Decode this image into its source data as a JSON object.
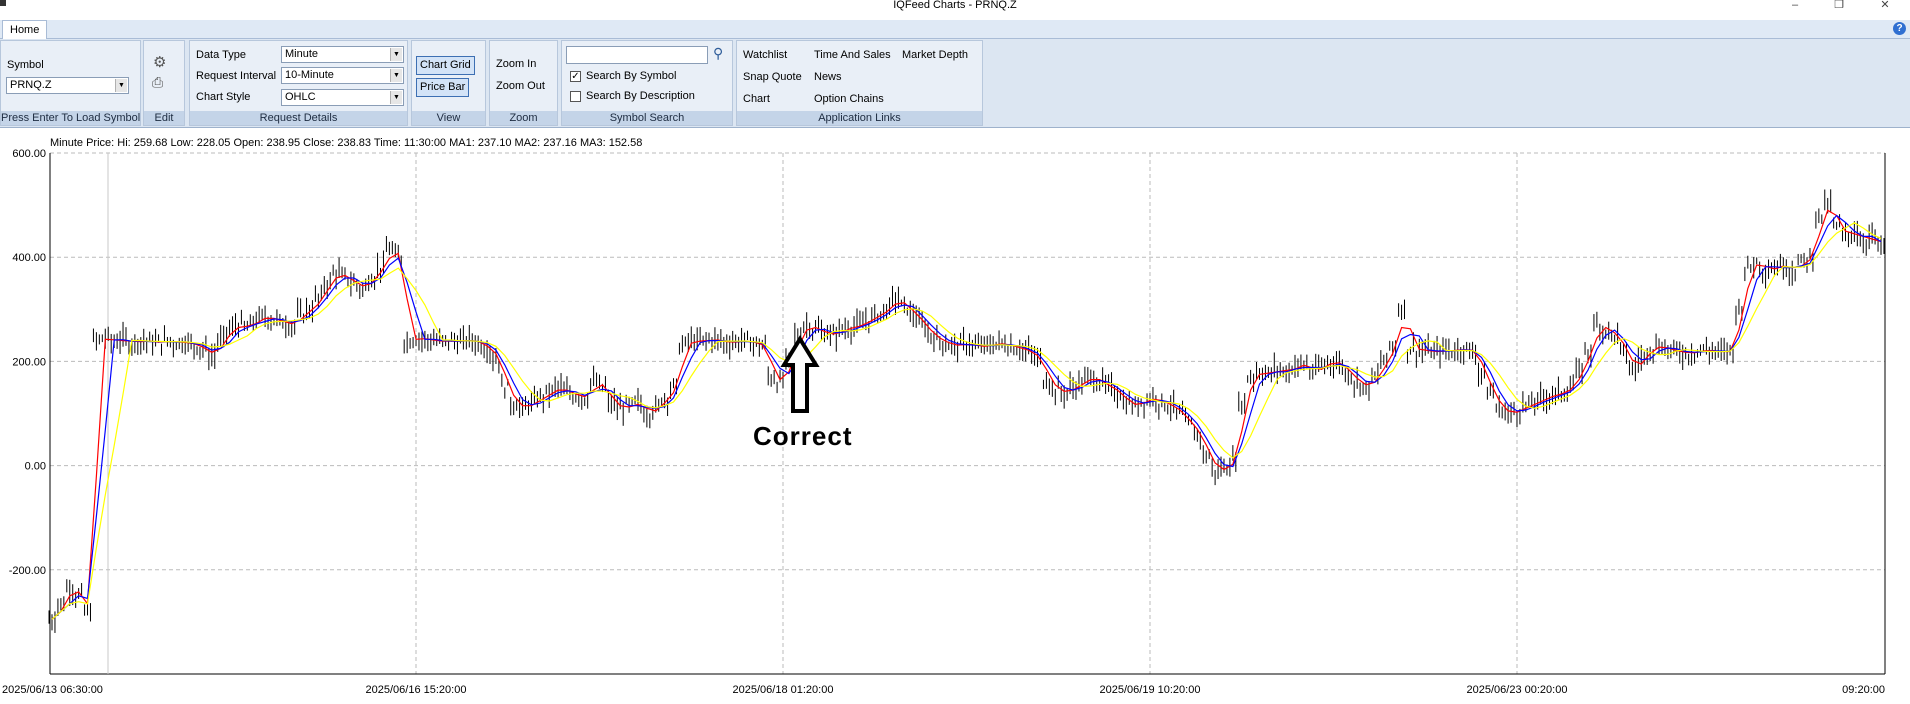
{
  "window": {
    "title": "IQFeed Charts - PRNQ.Z",
    "minimize_icon": "minimize-icon",
    "maximize_icon": "restore-icon",
    "close_icon": "close-icon"
  },
  "tabs": {
    "home": "Home"
  },
  "ribbon": {
    "symbol_group": {
      "label": "Symbol",
      "value": "PRNQ.Z",
      "footer": "Press Enter To Load Symbol"
    },
    "edit_group": {
      "footer": "Edit",
      "icons": [
        "settings-icon",
        "print-icon"
      ]
    },
    "request_group": {
      "data_type_label": "Data Type",
      "data_type_value": "Minute",
      "interval_label": "Request Interval",
      "interval_value": "10-Minute",
      "style_label": "Chart Style",
      "style_value": "OHLC",
      "footer": "Request Details"
    },
    "view_group": {
      "chart_grid": "Chart Grid",
      "price_bar": "Price Bar",
      "footer": "View"
    },
    "zoom_group": {
      "zoom_in": "Zoom In",
      "zoom_out": "Zoom Out",
      "footer": "Zoom"
    },
    "search_group": {
      "search_value": "",
      "by_symbol": "Search By Symbol",
      "by_symbol_checked": true,
      "by_description": "Search By Description",
      "by_description_checked": false,
      "footer": "Symbol Search"
    },
    "links_group": {
      "watchlist": "Watchlist",
      "time_and_sales": "Time And Sales",
      "market_depth": "Market Depth",
      "snap_quote": "Snap Quote",
      "news": "News",
      "chart": "Chart",
      "option_chains": "Option Chains",
      "footer": "Application Links"
    }
  },
  "info_line": "Minute Price: Hi: 259.68 Low: 228.05 Open: 238.95 Close: 238.83 Time: 11:30:00 MA1: 237.10   MA2: 237.16   MA3: 152.58",
  "annotation": {
    "text": "Correct",
    "arrow_icon": "up-arrow-icon"
  },
  "colors": {
    "bars": "#000000",
    "ma1": "#ff0000",
    "ma2": "#0000ff",
    "ma3": "#ffff00",
    "ribbon": "#dce6f2",
    "grid": "#bbbbbb"
  },
  "chart_data": {
    "type": "line",
    "grid": true,
    "ylim": [
      -400,
      600
    ],
    "y_ticks": [
      "600.00",
      "400.00",
      "200.00",
      "0.00",
      "-200.00"
    ],
    "x_ticks": [
      "2025/06/13 06:30:00",
      "2025/06/16 15:20:00",
      "2025/06/18 01:20:00",
      "2025/06/19 10:20:00",
      "2025/06/23 00:20:00",
      "09:20:00"
    ],
    "series": [
      {
        "values": [
          -295,
          -265,
          -235,
          -250,
          -280,
          240,
          245,
          238,
          242,
          236,
          240,
          238,
          236,
          240,
          235,
          238,
          230,
          225,
          210,
          240,
          260,
          270,
          265,
          280,
          285,
          280,
          275,
          270,
          290,
          300,
          320,
          350,
          370,
          360,
          350,
          340,
          360,
          380,
          415,
          400,
          240,
          245,
          242,
          240,
          238,
          240,
          238,
          242,
          235,
          225,
          205,
          150,
          120,
          110,
          120,
          130,
          140,
          150,
          140,
          135,
          130,
          160,
          150,
          120,
          110,
          115,
          120,
          100,
          110,
          130,
          150,
          230,
          240,
          238,
          242,
          240,
          236,
          238,
          240,
          235,
          230,
          170,
          160,
          200,
          250,
          270,
          260,
          255,
          250,
          262,
          265,
          270,
          280,
          290,
          300,
          320,
          305,
          290,
          270,
          250,
          240,
          232,
          230,
          235,
          228,
          230,
          232,
          235,
          228,
          225,
          218,
          205,
          165,
          145,
          140,
          150,
          160,
          170,
          160,
          150,
          140,
          120,
          115,
          125,
          130,
          120,
          115,
          100,
          80,
          60,
          20,
          -10,
          -5,
          10,
          120,
          170,
          180,
          175,
          185,
          180,
          190,
          195,
          180,
          190,
          200,
          195,
          175,
          160,
          150,
          170,
          200,
          230,
          300,
          225,
          222,
          220,
          218,
          222,
          220,
          225,
          218,
          180,
          140,
          110,
          100,
          105,
          115,
          120,
          130,
          135,
          140,
          150,
          180,
          220,
          270,
          260,
          250,
          220,
          185,
          205,
          225,
          230,
          222,
          220,
          215,
          218,
          222,
          220,
          218,
          220,
          300,
          380,
          390,
          375,
          380,
          385,
          375,
          390,
          400,
          480,
          500,
          460,
          440,
          450,
          430,
          440,
          420
        ]
      }
    ]
  }
}
